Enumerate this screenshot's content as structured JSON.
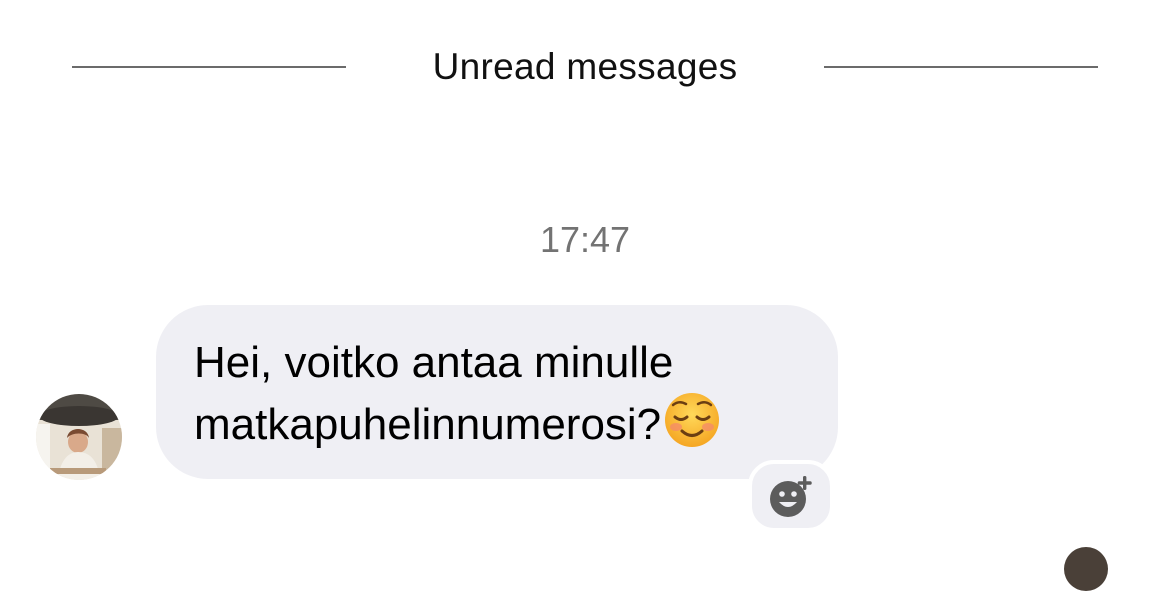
{
  "divider": {
    "label": "Unread messages"
  },
  "timestamp": "17:47",
  "message": {
    "line1": "Hei, voitko antaa minulle",
    "line2": "matkapuhelinnumerosi?",
    "emoji": "smiling-face-emoji"
  },
  "icons": {
    "reaction": "add-reaction-icon",
    "avatar": "sender-avatar"
  },
  "colors": {
    "bubble": "#efeff4",
    "timestamp": "#737373",
    "divider": "#6b6b6b",
    "reaction_icon": "#5c5c5c"
  }
}
